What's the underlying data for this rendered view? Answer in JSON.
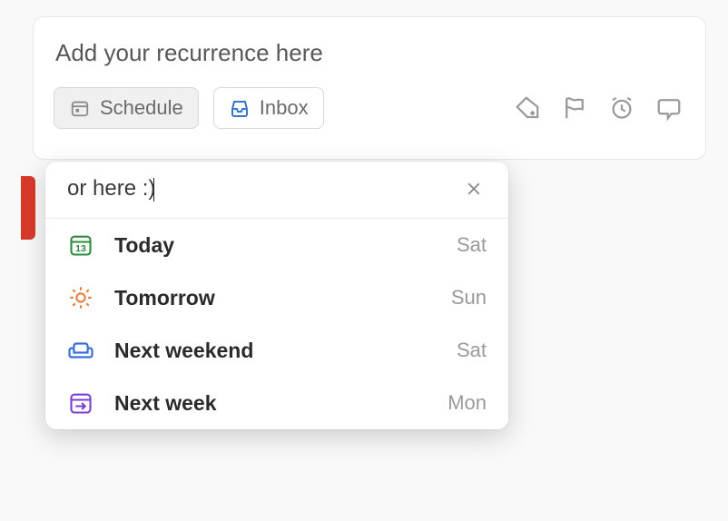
{
  "task": {
    "placeholder": "Add your recurrence here"
  },
  "chips": {
    "schedule": "Schedule",
    "inbox": "Inbox"
  },
  "scheduler": {
    "search_value": "or here :)",
    "options": [
      {
        "label": "Today",
        "day": "Sat",
        "icon": "calendar-13",
        "color": "#2b8a3e"
      },
      {
        "label": "Tomorrow",
        "day": "Sun",
        "icon": "sun",
        "color": "#e8803d"
      },
      {
        "label": "Next weekend",
        "day": "Sat",
        "icon": "couch",
        "color": "#3b6fd6"
      },
      {
        "label": "Next week",
        "day": "Mon",
        "icon": "arrow-right-box",
        "color": "#7a3fd1"
      }
    ]
  }
}
